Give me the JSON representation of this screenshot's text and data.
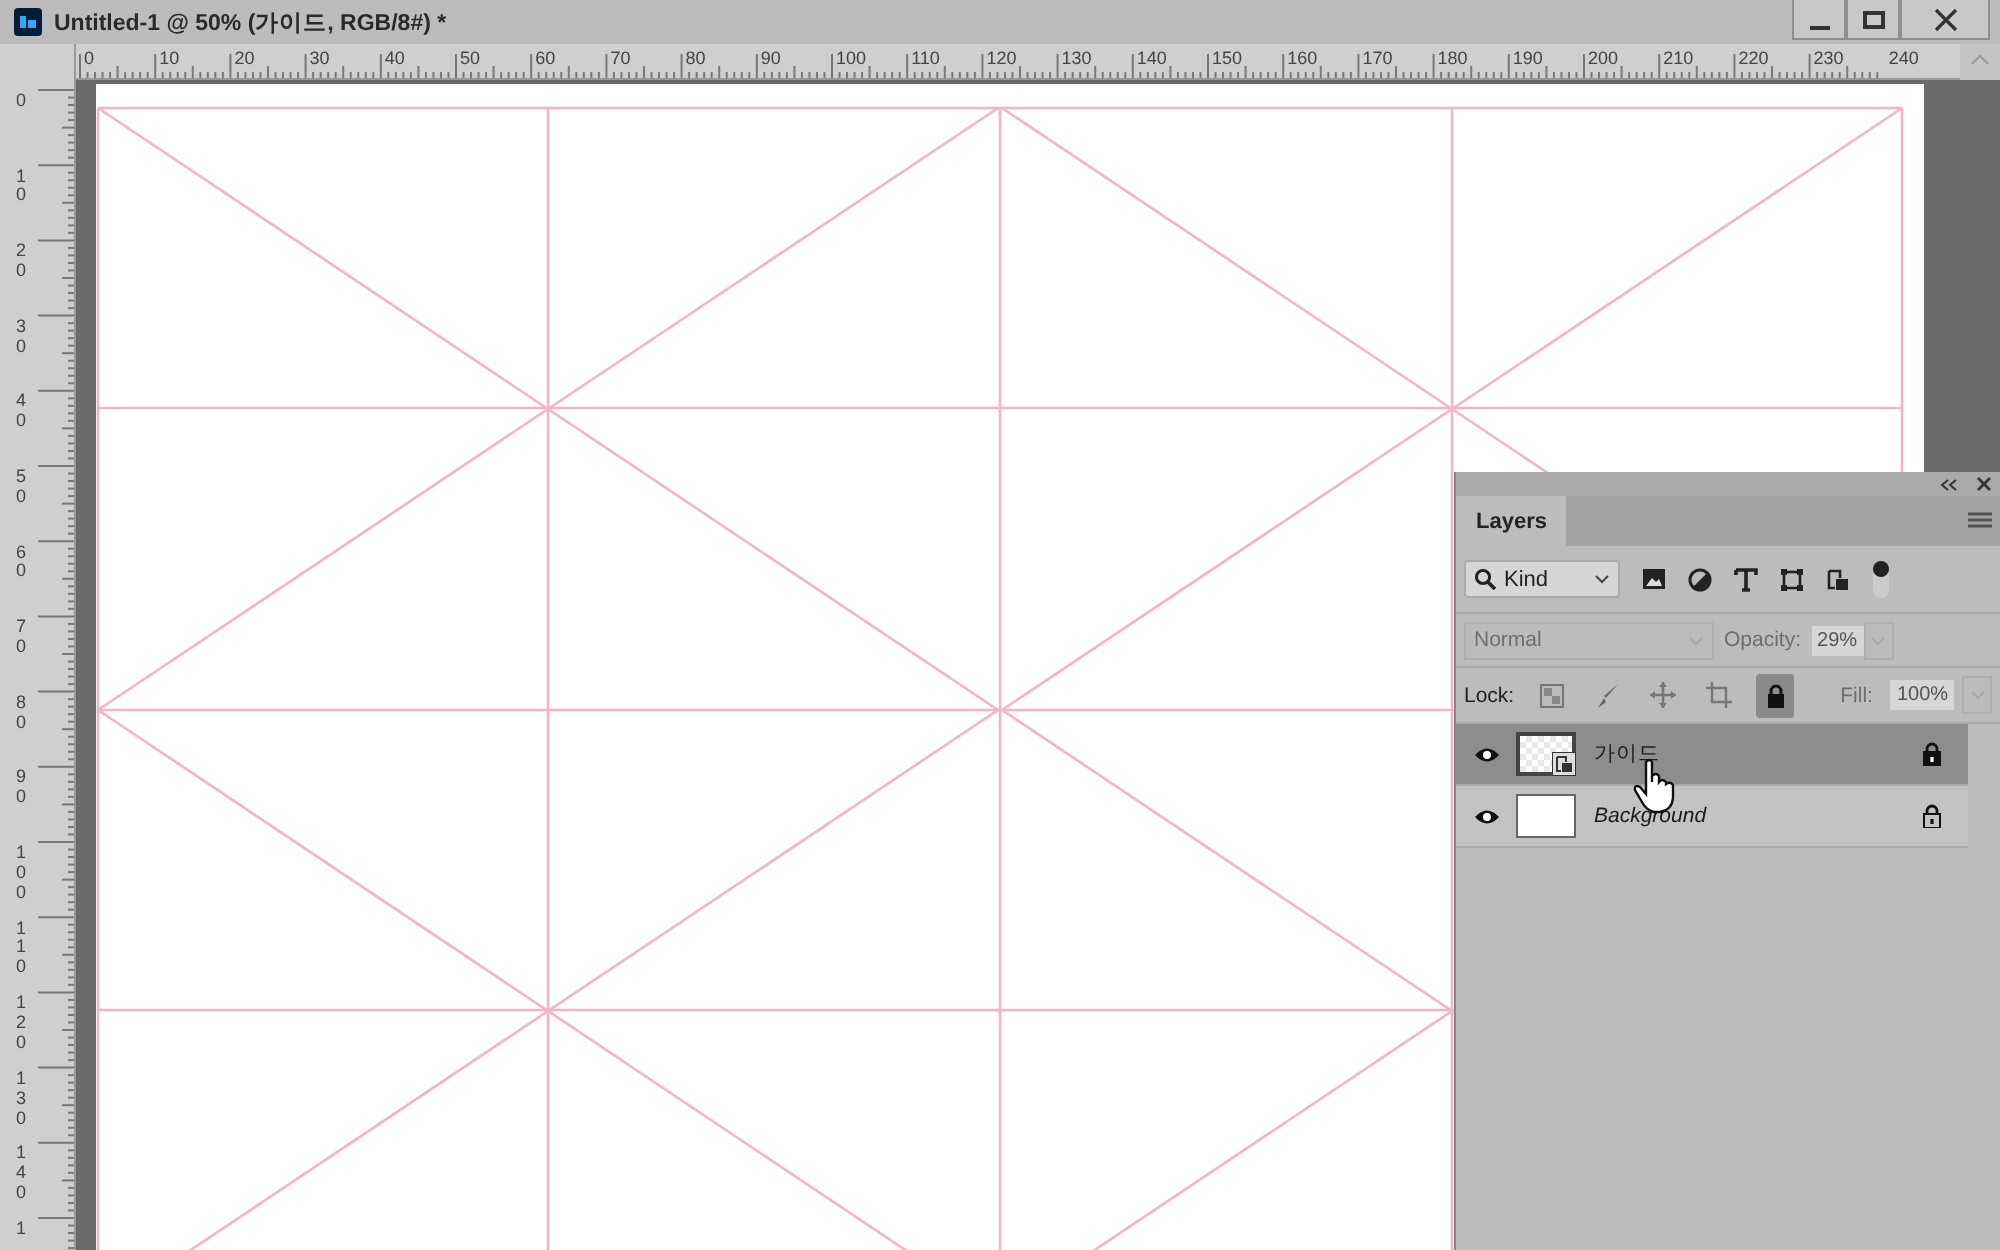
{
  "window": {
    "title": "Untitled-1 @ 50% (가이드, RGB/8#) *"
  },
  "rulers": {
    "horizontal": [
      "0",
      "10",
      "20",
      "30",
      "40",
      "50",
      "60",
      "70",
      "80",
      "90",
      "100",
      "110",
      "120",
      "130",
      "140",
      "150",
      "160",
      "170",
      "180",
      "190",
      "200",
      "210",
      "220",
      "230",
      "240"
    ],
    "vertical": [
      "0",
      "10",
      "20",
      "30",
      "40",
      "50",
      "60",
      "70",
      "80",
      "90",
      "100",
      "110",
      "120",
      "130",
      "140",
      "1"
    ]
  },
  "layers_panel": {
    "tab": "Layers",
    "filter": "Kind",
    "blend_mode": "Normal",
    "opacity_label": "Opacity:",
    "opacity": "29%",
    "lock_label": "Lock:",
    "fill_label": "Fill:",
    "fill": "100%",
    "locks": [
      {
        "kind": "transparent",
        "on": false
      },
      {
        "kind": "paint",
        "on": false
      },
      {
        "kind": "position",
        "on": false
      },
      {
        "kind": "artboard",
        "on": false
      },
      {
        "kind": "all",
        "on": true
      }
    ],
    "layers": [
      {
        "name": "가이드",
        "kind": "smart",
        "selected": true,
        "visible": true,
        "locked": true
      },
      {
        "name": "Background",
        "kind": "background",
        "selected": false,
        "visible": true,
        "locked": true
      }
    ]
  }
}
